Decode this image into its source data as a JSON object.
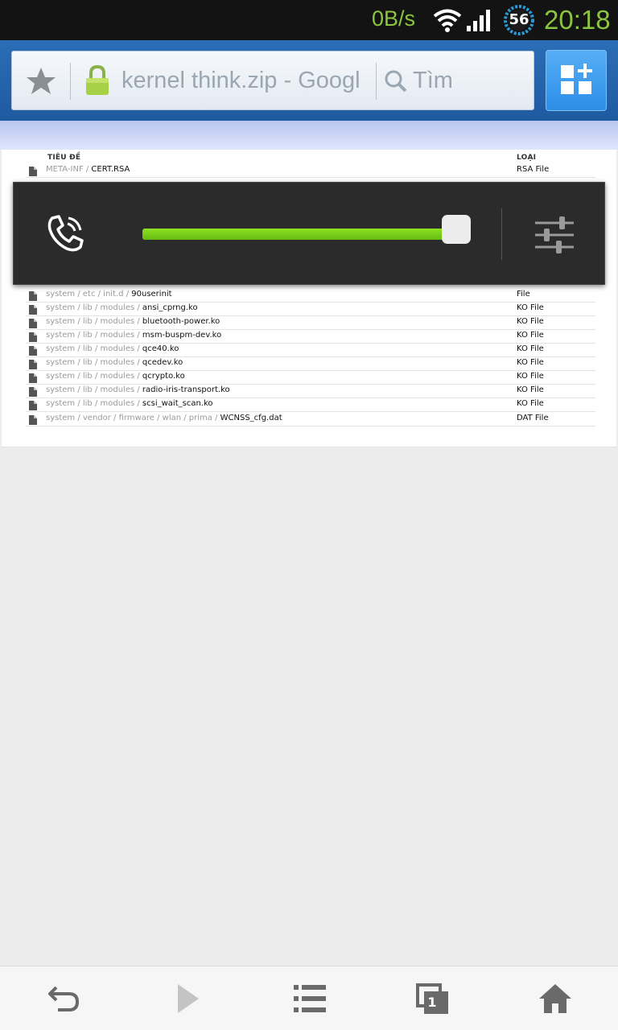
{
  "status_bar": {
    "net_speed": "0B/s",
    "badge": "56",
    "time": "20:18",
    "accent_color": "#8cc63f",
    "icons": [
      "wifi-icon",
      "signal-icon"
    ]
  },
  "toolbar": {
    "url_title": "kernel think.zip - Googl",
    "search_placeholder": "Tìm",
    "icons": [
      "star-icon",
      "lock-icon",
      "search-icon",
      "apps-add-icon"
    ]
  },
  "table": {
    "headers": {
      "title": "TIÊU ĐỀ",
      "type": "LOẠI"
    },
    "rows": [
      {
        "dir": "META-INF / ",
        "name": "CERT.RSA",
        "type": "RSA File"
      },
      {
        "dir": "system / etc / init.d / ",
        "name": "90userinit",
        "type": "File"
      },
      {
        "dir": "system / lib / modules / ",
        "name": "ansi_cprng.ko",
        "type": "KO File"
      },
      {
        "dir": "system / lib / modules / ",
        "name": "bluetooth-power.ko",
        "type": "KO File"
      },
      {
        "dir": "system / lib / modules / ",
        "name": "msm-buspm-dev.ko",
        "type": "KO File"
      },
      {
        "dir": "system / lib / modules / ",
        "name": "qce40.ko",
        "type": "KO File"
      },
      {
        "dir": "system / lib / modules / ",
        "name": "qcedev.ko",
        "type": "KO File"
      },
      {
        "dir": "system / lib / modules / ",
        "name": "qcrypto.ko",
        "type": "KO File"
      },
      {
        "dir": "system / lib / modules / ",
        "name": "radio-iris-transport.ko",
        "type": "KO File"
      },
      {
        "dir": "system / lib / modules / ",
        "name": "scsi_wait_scan.ko",
        "type": "KO File"
      },
      {
        "dir": "system / vendor / firmware / wlan / prima / ",
        "name": "WCNSS_cfg.dat",
        "type": "DAT File"
      }
    ]
  },
  "volume": {
    "level": 0.96,
    "fill_color": "#7ed21a",
    "icons": [
      "phone-call-icon",
      "equalizer-icon"
    ]
  },
  "bottom_nav": {
    "tab_count": "1",
    "icons": [
      "back-icon",
      "forward-icon",
      "menu-list-icon",
      "tabs-icon",
      "home-icon"
    ]
  }
}
